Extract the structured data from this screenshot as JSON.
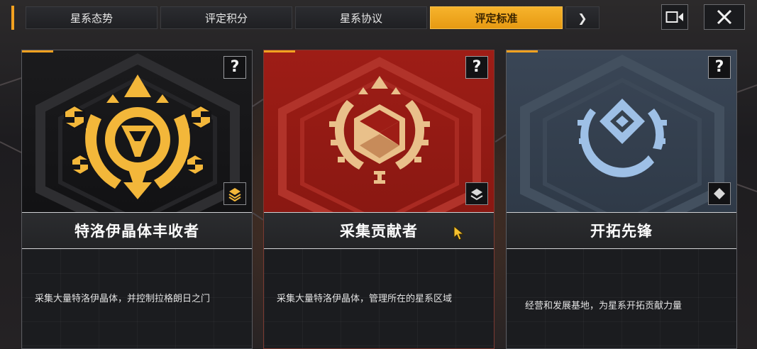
{
  "tabs": [
    {
      "label": "星系态势",
      "active": false
    },
    {
      "label": "评定积分",
      "active": false
    },
    {
      "label": "星系协议",
      "active": false
    },
    {
      "label": "评定标准",
      "active": true
    }
  ],
  "tabs_more_label": "❯",
  "top_buttons": {
    "record_icon": "video-camera-icon",
    "close_icon": "close-icon"
  },
  "colors": {
    "accent": "#f2a120",
    "card_dark": "#141416",
    "card_red": "#9a1c15",
    "card_steel": "#36424f",
    "emblem_gold": "#f3b73a",
    "emblem_tan": "#e9c08a",
    "emblem_blue": "#9ec0e6"
  },
  "cards": [
    {
      "title": "特洛伊晶体丰收者",
      "description": "采集大量特洛伊晶体，并控制拉格朗日之门",
      "help_label": "?",
      "rank_icon": "triple-chevron-rank-icon",
      "emblem_icon": "crystal-harvester-emblem-icon"
    },
    {
      "title": "采集贡献者",
      "description": "采集大量特洛伊晶体，管理所在的星系区域",
      "help_label": "?",
      "rank_icon": "double-chevron-rank-icon",
      "emblem_icon": "gathering-contributor-emblem-icon"
    },
    {
      "title": "开拓先锋",
      "description": "经营和发展基地，为星系开拓贡献力量",
      "help_label": "?",
      "rank_icon": "diamond-rank-icon",
      "emblem_icon": "pioneer-emblem-icon"
    }
  ]
}
